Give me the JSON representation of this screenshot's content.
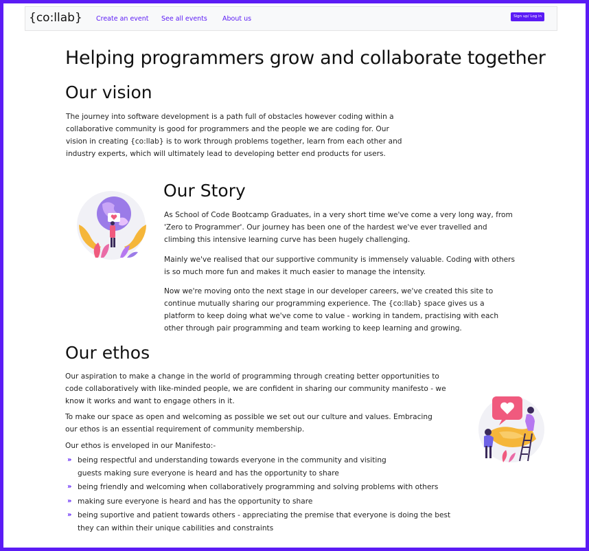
{
  "nav": {
    "brand": "{co:llab}",
    "links": [
      "Create an event",
      "See all events",
      "About us"
    ],
    "signup": "Sign up/ Log in"
  },
  "page_title": "Helping programmers grow and collaborate together",
  "vision": {
    "heading": "Our vision",
    "text": "The journey into software development is a path full of obstacles however coding within a collaborative community is good for programmers and the people we are coding for. Our vision in creating {co:llab} is to work through problems together, learn from each other and industry experts, which will ultimately lead to developing better end products for users."
  },
  "story": {
    "heading": "Our Story",
    "paragraphs": [
      "As School of Code Bootcamp Graduates, in a very short time we've come a very long way, from 'Zero to Programmer'. Our journey has been one of the hardest we've ever travelled and climbing this intensive learning curve has been hugely challenging.",
      "Mainly we've realised that our supportive community is immensely valuable. Coding with others is so much more fun and makes it much easier to manage the intensity.",
      "Now we're moving onto the next stage in our developer careers, we've created this site to continue mutually sharing our programming experience. The {co:llab} space gives us a platform to keep doing what we've come to value - working in tandem, practising with each other through pair programming and team working to keep learning and growing."
    ]
  },
  "ethos": {
    "heading": "Our ethos",
    "paragraphs": [
      "Our aspiration to make a change in the world of programming through creating better opportunities to code collaboratively with like-minded people, we are confident in sharing our community manifesto - we know it works and want to engage others in it.",
      "To make our space as open and welcoming as possible we set out our culture and values. Embracing our ethos is an essential requirement of community membership.",
      "Our ethos is enveloped in our Manifesto:-"
    ],
    "manifesto": [
      "being respectful and understanding towards everyone in the community and visiting guests making sure everyone is heard and has the opportunity to share",
      "being friendly and welcoming when collaboratively programming and solving problems with others",
      "making sure everyone is heard and has the opportunity to share",
      "being suportive and patient towards others - appreciating the premise that everyone is doing the best they can within their unique cabilities and constraints"
    ]
  },
  "colors": {
    "accent": "#5b1bf5",
    "frame": "#5b1bf5"
  },
  "icons": {
    "bullet": "double-chevron-right-icon",
    "story_illustration": "globe-in-hands-illustration",
    "ethos_illustration": "heart-handshake-illustration"
  }
}
